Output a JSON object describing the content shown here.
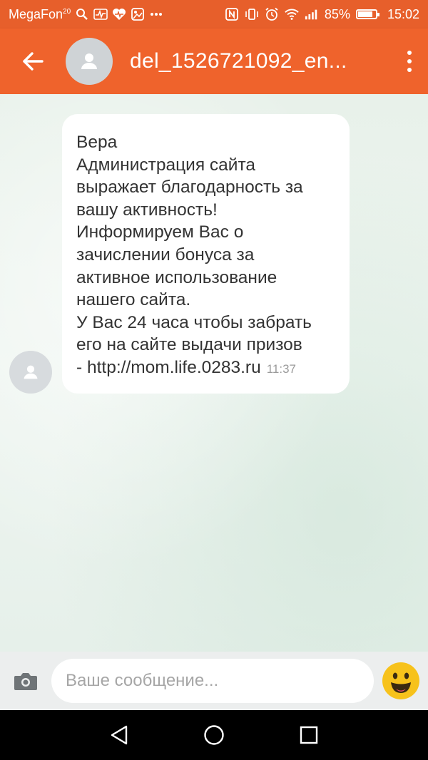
{
  "status_bar": {
    "carrier": "MegaFon",
    "network_badge": "20",
    "battery": "85%",
    "battery_level": 0.85,
    "time": "15:02",
    "left_icons": [
      "search-icon",
      "activity-icon",
      "heart-rate-icon",
      "gallery-icon",
      "more-notifications-icon"
    ],
    "right_icons": [
      "nfc-icon",
      "vibrate-icon",
      "alarm-icon",
      "wifi-icon",
      "signal-icon",
      "battery-icon"
    ]
  },
  "app_bar": {
    "back_icon": "arrow-left-icon",
    "avatar_icon": "person-icon",
    "title": "del_1526721092_en...",
    "menu_icon": "more-vert-icon"
  },
  "message": {
    "lines": [
      "Вера",
      "Администрация сайта",
      "выражает благодарность за",
      "вашу активность!",
      "Информируем Вас о",
      "зачислении бонуса за",
      "активное использование",
      "нашего сайта.",
      "У Вас 24 часа чтобы забрать",
      "его на сайте выдачи призов",
      "-  http://mom.life.0283.ru"
    ],
    "time": "11:37",
    "avatar_icon": "person-icon"
  },
  "composer": {
    "camera_icon": "camera-icon",
    "placeholder": "Ваше сообщение...",
    "value": "",
    "emoji_icon": "emoji-icon"
  },
  "nav_bar": {
    "icons": [
      "back-triangle-icon",
      "home-circle-icon",
      "recents-square-icon"
    ]
  },
  "colors": {
    "status_bar": "#e75f2b",
    "app_bar": "#ef632c",
    "bubble": "#ffffff",
    "emoji": "#f7c21b"
  }
}
